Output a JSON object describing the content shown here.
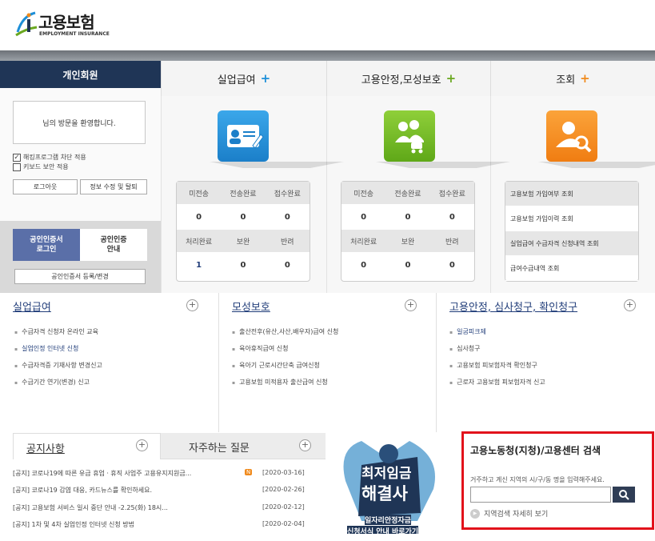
{
  "brand": {
    "name_ko": "고용보험",
    "name_en": "EMPLOYMENT INSURANCE"
  },
  "colors": {
    "navy": "#1f3556",
    "blue_plus": "#1d8fd8",
    "green_plus": "#6aa820",
    "orange_plus": "#f08a1c",
    "highlight_border": "#e2121b"
  },
  "left": {
    "tab": "개인회원",
    "welcome": "님의 방문을 환영합니다.",
    "check1": "해킹프로그램 차단 적용",
    "check2": "키보드 보안 적용",
    "check1_checked": true,
    "check2_checked": false,
    "logout": "로그아웃",
    "edit": "정보 수정 및 탈퇴",
    "cert_login": [
      "공인인증서",
      "로그인"
    ],
    "cert_guide": [
      "공인인증",
      "안내"
    ],
    "cert_register": "공인인증서 등록/변경"
  },
  "tabs": [
    {
      "label": "실업급여",
      "plus": "+"
    },
    {
      "label": "고용안정,모성보호",
      "plus": "+"
    },
    {
      "label": "조회",
      "plus": "+"
    }
  ],
  "stats": [
    {
      "row1": [
        "미전송",
        "전송완료",
        "접수완료"
      ],
      "row1_vals": [
        "0",
        "0",
        "0"
      ],
      "row2": [
        "처리완료",
        "보완",
        "반려"
      ],
      "row2_vals": [
        "1",
        "0",
        "0"
      ]
    },
    {
      "row1": [
        "미전송",
        "전송완료",
        "접수완료"
      ],
      "row1_vals": [
        "0",
        "0",
        "0"
      ],
      "row2": [
        "처리완료",
        "보완",
        "반려"
      ],
      "row2_vals": [
        "0",
        "0",
        "0"
      ]
    }
  ],
  "lookup": [
    "고용보험 가입여부 조회",
    "고용보험 가입이력 조회",
    "실업급여 수급자격 신청내역 조회",
    "급여수급내역 조회"
  ],
  "sections": [
    {
      "title": "실업급여",
      "items": [
        "수급자격 신청자 온라인 교육",
        "실업인정 인터넷 신청",
        "수급자격증 기재사항 변경신고",
        "수급기간 연기(변경) 신고"
      ]
    },
    {
      "title": "모성보호",
      "items": [
        "출산전후(유산,사산,배우자)급여 신청",
        "육아휴직급여 신청",
        "육아기 근로시간단축 급여신청",
        "고용보험 미적용자 출산급여 신청"
      ]
    },
    {
      "title": "고용안정, 심사청구, 확인청구",
      "items": [
        "일굼피크제",
        "심사청구",
        "고용보험 피보험자격 확인청구",
        "근로자 고용보험 피보험자격 신고"
      ]
    }
  ],
  "notice": {
    "tab1": "공지사항",
    "tab2": "자주하는 질문",
    "new_badge": "N",
    "rows": [
      {
        "text": "[공지] 코로나19에 따른 유급 휴업ㆍ휴직 사업주 고용유지지원금...",
        "date": "[2020-03-16]"
      },
      {
        "text": "[공지] 코로나19 감염 대응, 카드뉴스를 확인하세요.",
        "date": "[2020-02-26]"
      },
      {
        "text": "[공지] 고용보험 서비스 일시 중단 안내 -2.25(화) 18시...",
        "date": "[2020-02-12]"
      },
      {
        "text": "[공지] 1차 및 4차 실업인정 인터넷 신청 방법",
        "date": "[2020-02-04]"
      }
    ]
  },
  "banner": {
    "line1": "최저임금",
    "line2": "해결사",
    "line3": "일자리안정자금",
    "line4": "신청서식 안내 바로가기"
  },
  "search": {
    "title": "고용노동청(지청)/고용센터 검색",
    "desc": "거주하고 계신 지역의 시/구/동 명을 입력해주세요.",
    "more": "지역검색 자세히 보기"
  }
}
